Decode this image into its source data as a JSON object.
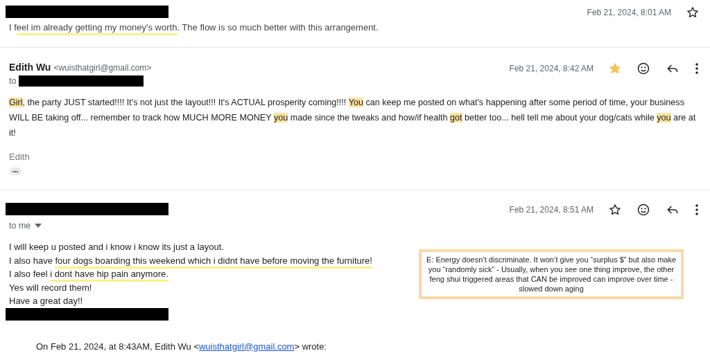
{
  "messages": [
    {
      "sender_redacted": true,
      "date": "Feb 21, 2024, 8:01 AM",
      "starred": false,
      "expanded": false,
      "snippet": [
        {
          "text": "I f",
          "kind": "plain"
        },
        {
          "text": "eel im already getting my money's worth",
          "kind": "underline"
        },
        {
          "text": ". The flow is so much better with this arrangement.",
          "kind": "plain"
        }
      ]
    },
    {
      "sender_redacted": false,
      "sender": "Edith Wu",
      "email": "<wuisthatgirl@gmail.com>",
      "to_label": "to",
      "recipient_redacted": true,
      "date": "Feb 21, 2024, 8:42 AM",
      "starred": true,
      "expanded": true,
      "paragraphs": [
        [
          {
            "text": "Girl",
            "kind": "highlight"
          },
          {
            "text": ", the party JUST started!!!! It's not just the layout!!! It's ACTUAL prosperity coming!!!! ",
            "kind": "plain"
          },
          {
            "text": "You",
            "kind": "highlight"
          },
          {
            "text": " can keep me posted on what's happening after some period of time, your business WILL BE taking off... remember to track how MUCH MORE MONEY ",
            "kind": "plain"
          },
          {
            "text": "you",
            "kind": "highlight"
          },
          {
            "text": " made since the tweaks and how/if health ",
            "kind": "plain"
          },
          {
            "text": "got",
            "kind": "highlight"
          },
          {
            "text": " better too... hell tell me about your dog/cats while ",
            "kind": "plain"
          },
          {
            "text": "you",
            "kind": "highlight"
          },
          {
            "text": " are at it!",
            "kind": "plain"
          }
        ]
      ],
      "signature": "Edith",
      "trimmed_button": "•••"
    },
    {
      "sender_redacted": true,
      "to_label": "to me",
      "date": "Feb 21, 2024, 8:51 AM",
      "starred": false,
      "expanded": true,
      "lines": [
        [
          {
            "text": "I will keep u posted and i know i know its just a layout.",
            "kind": "plain"
          }
        ],
        [
          {
            "text": "I also have ",
            "kind": "plain"
          },
          {
            "text": "four dogs boarding this weekend which i didnt have before moving the furniture!",
            "kind": "underline"
          }
        ],
        [
          {
            "text": "I also feel ",
            "kind": "plain"
          },
          {
            "text": "i dont have hip pain anymore.",
            "kind": "underline"
          }
        ],
        [
          {
            "text": "Yes will record them!",
            "kind": "plain"
          }
        ],
        [
          {
            "text": "Have a great day!!",
            "kind": "plain"
          }
        ]
      ],
      "signoff_redacted": true,
      "note": "E: Energy doesn’t discriminate. It won’t give you “surplus $” but also make you “randomly sick” - Usually, when you see one thing improve, the other feng shui triggered areas that CAN be improved can improve over time - slowed down aging",
      "quote": {
        "prefix": "On Feb 21, 2024, at 8:43AM, Edith Wu <",
        "link": "wuisthatgirl@gmail.com",
        "suffix": "> wrote:"
      }
    }
  ]
}
